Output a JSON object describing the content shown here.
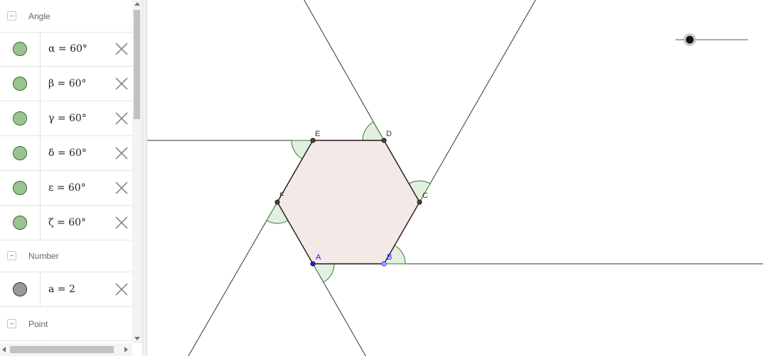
{
  "algebra_view": {
    "categories": {
      "angle": "Angle",
      "number": "Number",
      "point": "Point"
    },
    "angles": [
      {
        "expr": "α = 60°",
        "color": "#99c48f"
      },
      {
        "expr": "β = 60°",
        "color": "#99c48f"
      },
      {
        "expr": "γ = 60°",
        "color": "#99c48f"
      },
      {
        "expr": "δ = 60°",
        "color": "#99c48f"
      },
      {
        "expr": "ε = 60°",
        "color": "#99c48f"
      },
      {
        "expr": "ζ = 60°",
        "color": "#99c48f"
      }
    ],
    "numbers": [
      {
        "expr": "a = 2",
        "color": "#999999"
      }
    ]
  },
  "graphics_view": {
    "points": {
      "A": "A",
      "B": "B",
      "C": "C",
      "D": "D",
      "E": "E",
      "F": "F"
    },
    "colors": {
      "polygon_fill": "#f3e9e6",
      "angle_fill": "#e3efe0",
      "angle_stroke": "#2f7a2f",
      "free_point": "#1a1aff",
      "dependent_point": "#444444"
    },
    "slider": {
      "name": "a",
      "value": 2
    }
  }
}
